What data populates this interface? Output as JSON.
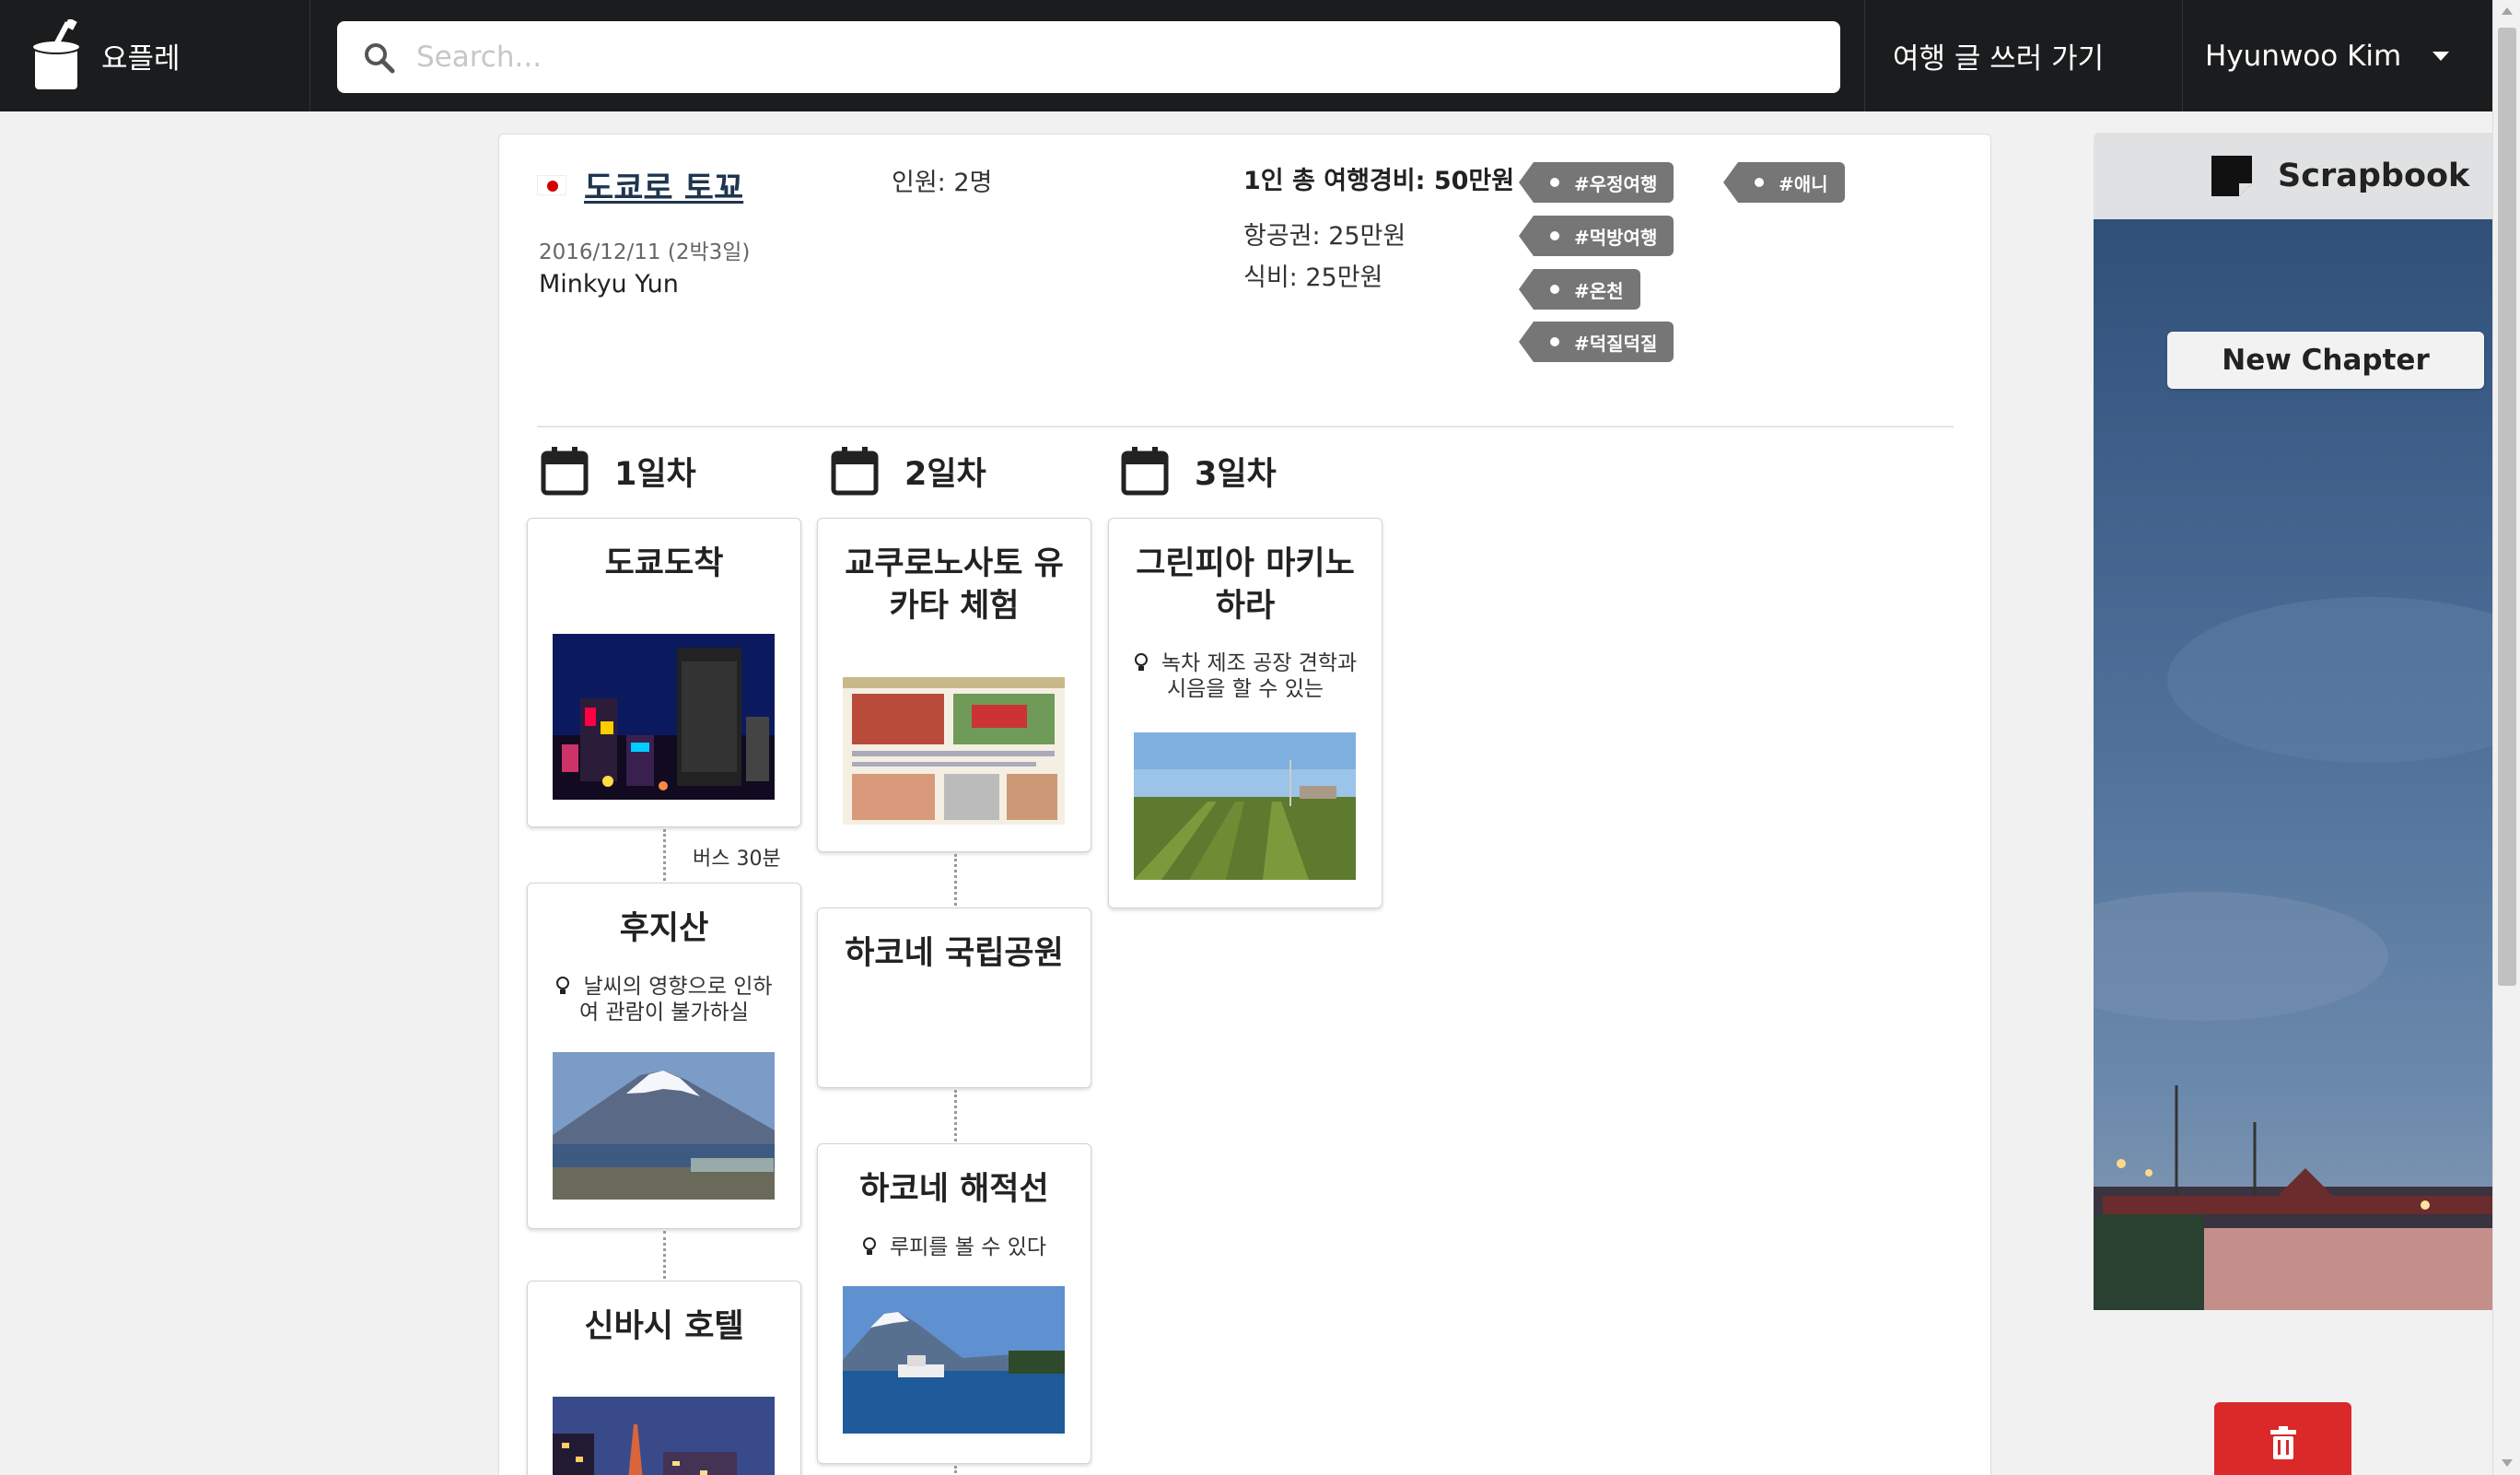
{
  "nav": {
    "brand": "요플레",
    "search_placeholder": "Search...",
    "write_link": "여행 글 쓰러 가기",
    "user_name": "Hyunwoo Kim"
  },
  "trip": {
    "title": "도쿄로 토꾜",
    "date": "2016/12/11 (2박3일)",
    "author": "Minkyu Yun",
    "people": "인원: 2명",
    "cost_total": "1인 총 여행경비: 50만원",
    "cost_flight": "항공권: 25만원",
    "cost_food": "식비: 25만원",
    "tags": [
      "#우정여행",
      "#먹방여행",
      "#온천",
      "#덕질덕질",
      "#애니"
    ]
  },
  "days": [
    {
      "label": "1일차",
      "places": [
        {
          "title": "도쿄도착",
          "note": ""
        },
        {
          "title": "후지산",
          "note": "날씨의 영향으로 인하여 관람이 불가하실"
        },
        {
          "title": "신바시 호텔",
          "note": ""
        }
      ],
      "transits": [
        "버스 30분"
      ]
    },
    {
      "label": "2일차",
      "places": [
        {
          "title": "교쿠로노사토 유카타 체험",
          "note": ""
        },
        {
          "title": "하코네 국립공원",
          "note": ""
        },
        {
          "title": "하코네 해적선",
          "note": "루피를 볼 수 있다"
        }
      ]
    },
    {
      "label": "3일차",
      "places": [
        {
          "title": "그린피아 마키노하라",
          "note": "녹차 제조 공장 견학과 시음을 할 수 있는"
        }
      ]
    }
  ],
  "scrapbook": {
    "title": "Scrapbook",
    "new_chapter": "New Chapter"
  },
  "colors": {
    "navbar": "#1b1c1d",
    "tag": "#767676",
    "delete": "#db2828",
    "title_link": "#1f3550"
  }
}
